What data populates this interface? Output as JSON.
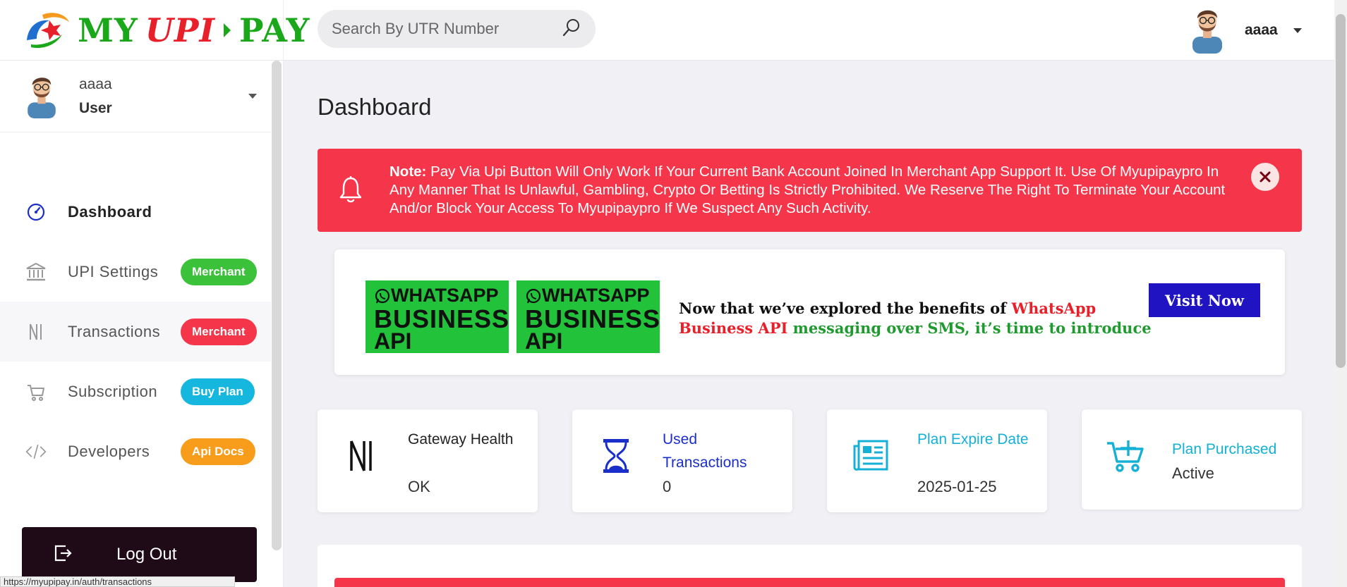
{
  "brand": {
    "logo_part1": "MY",
    "logo_part2": "UPI",
    "logo_part3": "PAY"
  },
  "search": {
    "placeholder": "Search By UTR Number"
  },
  "header_user": {
    "name": "aaaa"
  },
  "sidebar": {
    "user_name": "aaaa",
    "user_role": "User",
    "items": [
      {
        "label": "Dashboard",
        "badge": ""
      },
      {
        "label": "UPI Settings",
        "badge": "Merchant"
      },
      {
        "label": "Transactions",
        "badge": "Merchant"
      },
      {
        "label": "Subscription",
        "badge": "Buy Plan"
      },
      {
        "label": "Developers",
        "badge": "Api Docs"
      }
    ],
    "logout_label": "Log Out",
    "status_url": "https://myupipay.in/auth/transactions"
  },
  "main": {
    "title": "Dashboard",
    "alert": {
      "note_label": "Note:",
      "message": " Pay Via Upi Button Will Only Work If Your Current Bank Account Joined In Merchant App Support It. Use Of Myupipaypro In Any Manner That Is Unlawful, Gambling, Crypto Or Betting Is Strictly Prohibited. We Reserve The Right To Terminate Your Account And/or Block Your Access To Myupipaypro If We Suspect Any Such Activity."
    },
    "ad": {
      "badge_top": "WHATSAPP",
      "badge_mid": "BUSINESS",
      "badge_bot": "API",
      "text_part1": "Now that we’ve explored the benefits of ",
      "text_part2": "WhatsApp Business API",
      "text_part3": " messaging over SMS, it’s time to introduce",
      "button_label": "Visit Now"
    },
    "stats": [
      {
        "label": "Gateway Health",
        "value": "OK",
        "label_color": "#222222"
      },
      {
        "label": "Used Transactions",
        "value": "0",
        "label_color": "#1a2fc9"
      },
      {
        "label": "Plan Expire Date",
        "value": "2025-01-25",
        "label_color": "#14b0d6"
      },
      {
        "label": "Plan Purchased",
        "value": "Active",
        "label_color": "#14b0d6"
      }
    ]
  },
  "colors": {
    "alert_red": "#f5364a",
    "badge_green": "#3cc13b",
    "badge_blue": "#15b7df",
    "badge_orange": "#f89c1c",
    "logout_bg": "#1f0a17",
    "ad_green": "#22c33a",
    "visit_blue": "#2013c1"
  },
  "icons": {
    "alert": "bell-icon",
    "close": "close-icon",
    "search": "search-icon",
    "dashboard": "gauge-icon",
    "upi_settings": "bank-icon",
    "transactions": "rupee-icon",
    "subscription": "cart-icon",
    "developers": "code-icon",
    "logout": "logout-icon",
    "gateway": "rupee-icon",
    "used_transactions": "hourglass-icon",
    "plan_expire": "newspaper-icon",
    "plan_purchased": "cart-plus-icon"
  }
}
